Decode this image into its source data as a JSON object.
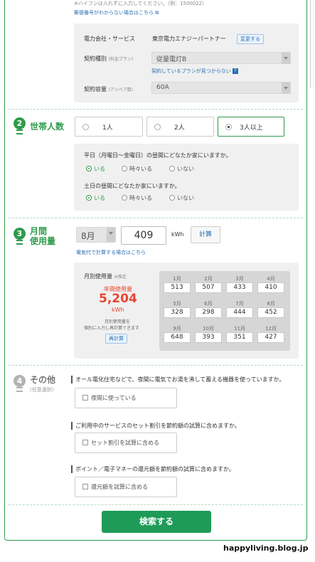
{
  "top": {
    "hyphen_note": "※ハイフンは入れずに入力してください。（例：1500022）",
    "postal_unknown_link": "郵便番号がわからない場合はこちら"
  },
  "contract": {
    "company_label": "電力会社・サービス",
    "company_value": "東京電力エナジーパートナー",
    "change_button": "変更する",
    "type_label": "契約種別",
    "type_sub": "(料金プラン)",
    "type_value": "従量電灯B",
    "plan_not_found_link": "契約しているプランが見つからない",
    "capacity_label": "契約容量",
    "capacity_sub": "(アンペア数)",
    "capacity_value": "60A"
  },
  "section2": {
    "number": "2",
    "title": "世帯人数",
    "options": [
      "1人",
      "2人",
      "3人以上"
    ],
    "selected_index": 2,
    "q_weekday": "平日（月曜日〜金曜日）の昼間にどなたか家にいますか。",
    "q_weekend": "土日の昼間にどなたか家にいますか。",
    "presence_options": [
      "いる",
      "時々いる",
      "いない"
    ]
  },
  "section3": {
    "number": "3",
    "title_line1": "月間",
    "title_line2": "使用量",
    "month_value": "8月",
    "usage_value": "409",
    "unit": "kWh",
    "calc_button": "計算",
    "calc_link": "電気代で計算する場合はこちら",
    "monthly_label": "月別使用量",
    "estimate_tag": "※推定",
    "annual_label": "年間使用量",
    "annual_value": "5,204",
    "annual_unit": "kWh",
    "recalc_note_1": "月別使用量を",
    "recalc_note_2": "個別に入力し再計算できます",
    "recalc_button": "再計算",
    "months": [
      {
        "m": "1月",
        "v": "513"
      },
      {
        "m": "2月",
        "v": "507"
      },
      {
        "m": "3月",
        "v": "433"
      },
      {
        "m": "4月",
        "v": "410"
      },
      {
        "m": "5月",
        "v": "328"
      },
      {
        "m": "6月",
        "v": "298"
      },
      {
        "m": "7月",
        "v": "444"
      },
      {
        "m": "8月",
        "v": "452"
      },
      {
        "m": "9月",
        "v": "648"
      },
      {
        "m": "10月",
        "v": "393"
      },
      {
        "m": "11月",
        "v": "351"
      },
      {
        "m": "12月",
        "v": "427"
      }
    ]
  },
  "section4": {
    "number": "4",
    "title": "その他",
    "subtitle": "(任意選択)",
    "q1": "オール電化住宅などで、夜間に電気でお湯を沸して蓄える機器を使っていますか。",
    "c1": "夜間に使っている",
    "q2": "ご利用中のサービスのセット割引を節約額の試算に含めますか。",
    "c2": "セット割引を試算に含める",
    "q3": "ポイント／電子マネーの還元額を節約額の試算に含めますか。",
    "c3": "還元額を試算に含める"
  },
  "search_button": "検索する",
  "watermark": "happyliving.blog.jp",
  "colors": {
    "accent": "#2e9b4c",
    "button": "#1e9b57",
    "link": "#2b6fb5",
    "annual": "#e8462f"
  }
}
